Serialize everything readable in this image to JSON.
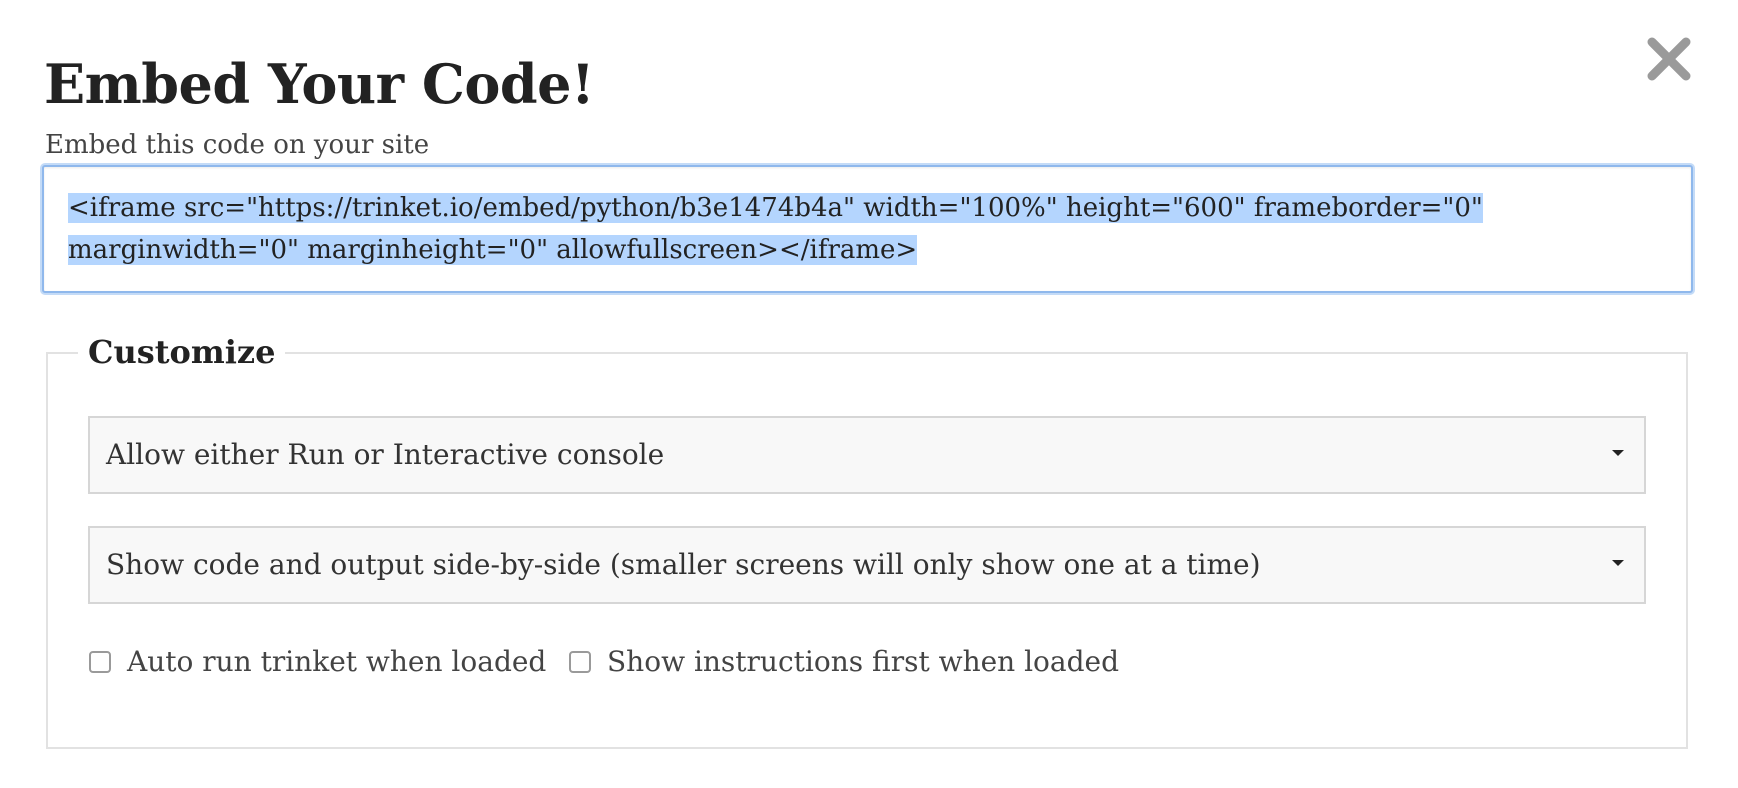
{
  "dialog": {
    "title": "Embed Your Code!",
    "subtitle": "Embed this code on your site",
    "close_icon": "close-icon"
  },
  "embed_code": {
    "line1": "<iframe src=\"https://trinket.io/embed/python/b3e1474b4a\" width=\"100%\" height=\"600\" frameborder=\"0\"",
    "line2": "marginwidth=\"0\" marginheight=\"0\" allowfullscreen></iframe>",
    "selected": true
  },
  "customize": {
    "legend": "Customize",
    "console_select": {
      "value": "Allow either Run or Interactive console"
    },
    "display_select": {
      "value": "Show code and output side-by-side (smaller screens will only show one at a time)"
    },
    "options": [
      {
        "label": "Auto run trinket when loaded",
        "checked": false
      },
      {
        "label": "Show instructions first when loaded",
        "checked": false
      }
    ]
  },
  "colors": {
    "selection": "#b4d5fe",
    "focus_border": "#8fb8ec",
    "select_bg": "#f8f8f8",
    "close_icon": "#9a9a9a"
  }
}
